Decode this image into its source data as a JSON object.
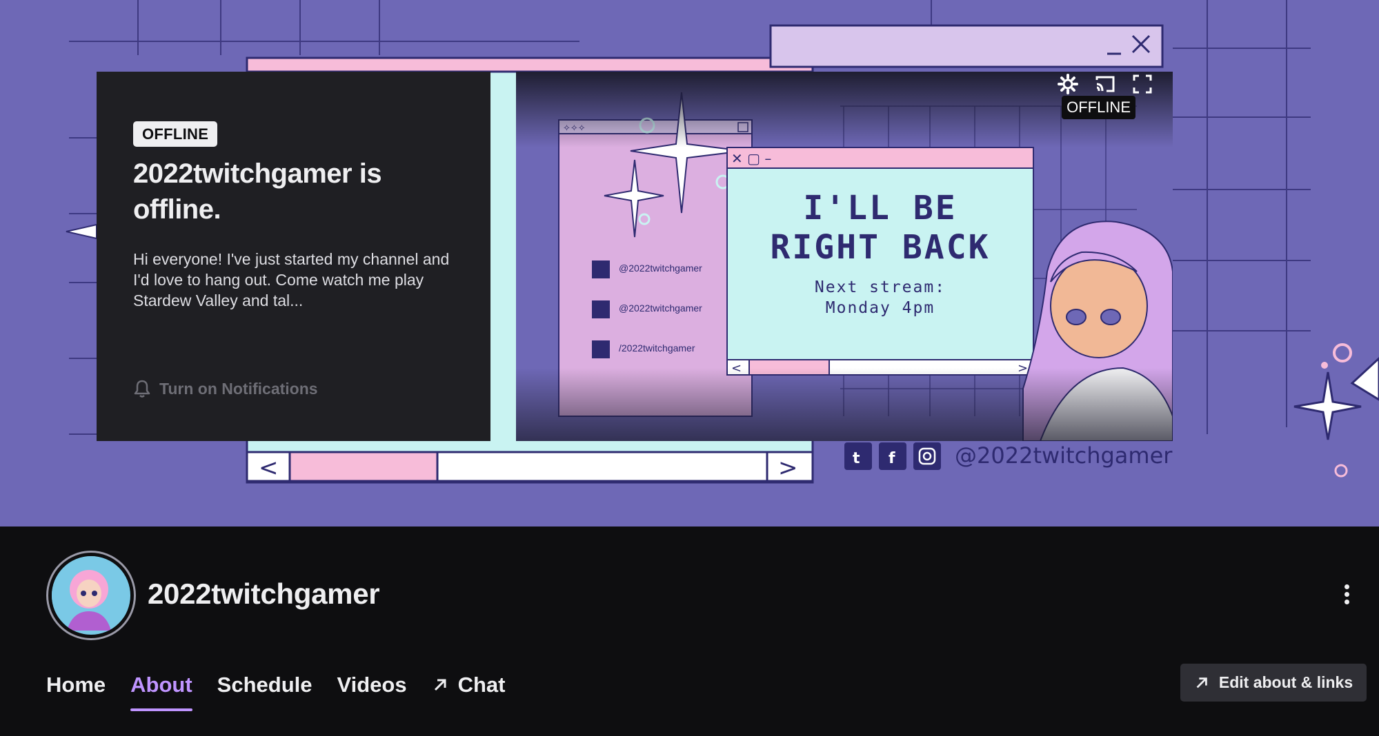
{
  "banner": {
    "handle": "@2022twitchgamer"
  },
  "offline_card": {
    "badge": "OFFLINE",
    "title": "2022twitchgamer is offline.",
    "description": "Hi everyone! I've just started my channel and I'd love to hang out. Come watch me play Stardew Valley and tal...",
    "notifications_label": "Turn on Notifications"
  },
  "player": {
    "status_badge": "OFFLINE",
    "brb_line1": "I'LL BE",
    "brb_line2": "RIGHT BACK",
    "next_stream_label": "Next stream:",
    "next_stream_time": "Monday 4pm",
    "socials": [
      "@2022twitchgamer",
      "@2022twitchgamer",
      "/2022twitchgamer"
    ]
  },
  "channel": {
    "name": "2022twitchgamer"
  },
  "tabs": [
    {
      "label": "Home",
      "active": false
    },
    {
      "label": "About",
      "active": true
    },
    {
      "label": "Schedule",
      "active": false
    },
    {
      "label": "Videos",
      "active": false
    },
    {
      "label": "Chat",
      "active": false
    }
  ],
  "edit_button": {
    "label": "Edit about & links"
  },
  "icons": {
    "notifications": "bell-icon",
    "chat": "arrow-up-right-icon",
    "edit": "arrow-up-right-icon",
    "more": "more-vertical-icon",
    "settings": "gear-icon",
    "cast": "cast-icon",
    "fullscreen": "fullscreen-icon"
  },
  "colors": {
    "accent": "#bf94ff",
    "banner_bg": "#6e68b6",
    "card_bg": "#1f1f23",
    "page_bg": "#0e0e10"
  }
}
